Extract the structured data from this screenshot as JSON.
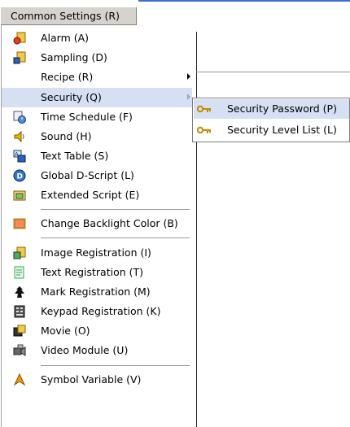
{
  "menubar": {
    "title": "Common Settings (R)"
  },
  "menu": {
    "items": [
      {
        "label": "Alarm (A)",
        "icon": "alarm-icon"
      },
      {
        "label": "Sampling (D)",
        "icon": "sampling-icon"
      },
      {
        "label": "Recipe (R)",
        "icon": "",
        "submenu": true
      },
      {
        "label": "Security (Q)",
        "icon": "",
        "submenu": true,
        "highlighted": true
      },
      {
        "label": "Time Schedule (F)",
        "icon": "time-schedule-icon"
      },
      {
        "label": "Sound (H)",
        "icon": "sound-icon"
      },
      {
        "label": "Text Table (S)",
        "icon": "text-table-icon"
      },
      {
        "label": "Global D-Script (L)",
        "icon": "global-d-script-icon"
      },
      {
        "label": "Extended Script (E)",
        "icon": "extended-script-icon"
      },
      {
        "label": "Change Backlight Color (B)",
        "icon": "backlight-color-icon"
      },
      {
        "label": "Image Registration (I)",
        "icon": "image-registration-icon"
      },
      {
        "label": "Text Registration (T)",
        "icon": "text-registration-icon"
      },
      {
        "label": "Mark Registration (M)",
        "icon": "mark-registration-icon"
      },
      {
        "label": "Keypad Registration (K)",
        "icon": "keypad-registration-icon"
      },
      {
        "label": "Movie (O)",
        "icon": "movie-icon"
      },
      {
        "label": "Video Module (U)",
        "icon": "video-module-icon"
      },
      {
        "label": "Symbol Variable (V)",
        "icon": "symbol-variable-icon"
      }
    ]
  },
  "submenu": {
    "items": [
      {
        "label": "Security Password (P)",
        "icon": "key-icon",
        "highlighted": true
      },
      {
        "label": "Security Level List (L)",
        "icon": "key-icon"
      }
    ]
  },
  "colors": {
    "highlight": "#d5e0f2",
    "menubar": "#d6d3ce",
    "titlebar_accent": "#3b6fd8"
  }
}
